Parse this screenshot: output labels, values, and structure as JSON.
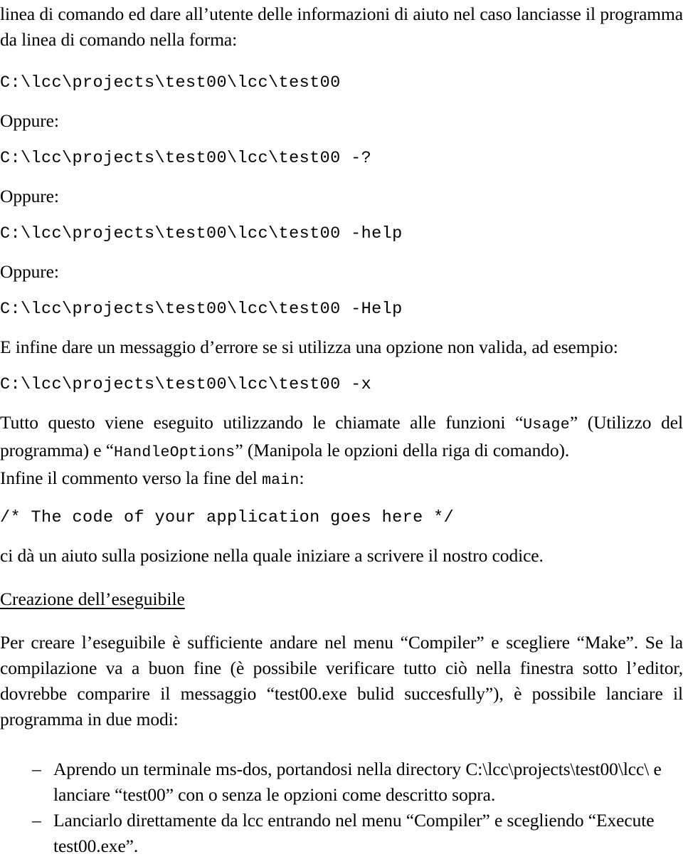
{
  "document": {
    "language": "it",
    "text_color": "#000000",
    "background_color": "#ffffff",
    "blocks": {
      "intro_paragraph": "linea di comando ed dare all’utente delle informazioni di aiuto nel caso lanciasse il programma da linea di comando nella forma:",
      "code_plain": "C:\\lcc\\projects\\test00\\lcc\\test00",
      "oppure_1": "Oppure:",
      "code_question": "C:\\lcc\\projects\\test00\\lcc\\test00 -?",
      "oppure_2": "Oppure:",
      "code_help_lower": "C:\\lcc\\projects\\test00\\lcc\\test00 -help",
      "oppure_3": "Oppure:",
      "code_help_upper": "C:\\lcc\\projects\\test00\\lcc\\test00 -Help",
      "error_intro": "E infine dare un messaggio d’errore se si utilizza una opzione non valida, ad esempio:",
      "code_invalid": "C:\\lcc\\projects\\test00\\lcc\\test00 -x",
      "functions_para": {
        "segment_1": "Tutto questo viene eseguito utilizzando le chiamate alle funzioni “",
        "mono_usage": "Usage",
        "segment_2": "” (Utilizzo del programma) e “",
        "mono_handleoptions": "HandleOptions",
        "segment_3": "” (Manipola le opzioni della riga di comando)."
      },
      "main_comment_line": {
        "segment_1": "Infine il commento verso la fine del ",
        "mono_main": "main",
        "segment_2": ":"
      },
      "code_comment": "/* The code of your application goes here */",
      "code_comment_note": "ci dà un aiuto sulla posizione nella quale iniziare a scrivere il nostro codice.",
      "section_heading": "Creazione dell’eseguibile",
      "build_paragraph": "Per creare l’eseguibile è sufficiente andare nel menu “Compiler” e scegliere “Make”. Se la compilazione va a buon fine (è possibile verificare tutto ciò nella finestra sotto l’editor, dovrebbe comparire il messaggio “test00.exe bulid succesfully”), è possibile lanciare il programma in due modi:"
    },
    "bullets": {
      "marker": "–",
      "items": [
        {
          "line_1": "Aprendo un terminale ms-dos, portandosi nella directory C:\\lcc\\projects\\test00\\lcc\\ e",
          "line_2": "lanciare “test00” con o senza le opzioni come descritto sopra."
        },
        {
          "line_1": "Lanciarlo direttamente da lcc entrando nel menu “Compiler” e scegliendo “Execute",
          "line_2": "test00.exe”."
        }
      ]
    }
  }
}
